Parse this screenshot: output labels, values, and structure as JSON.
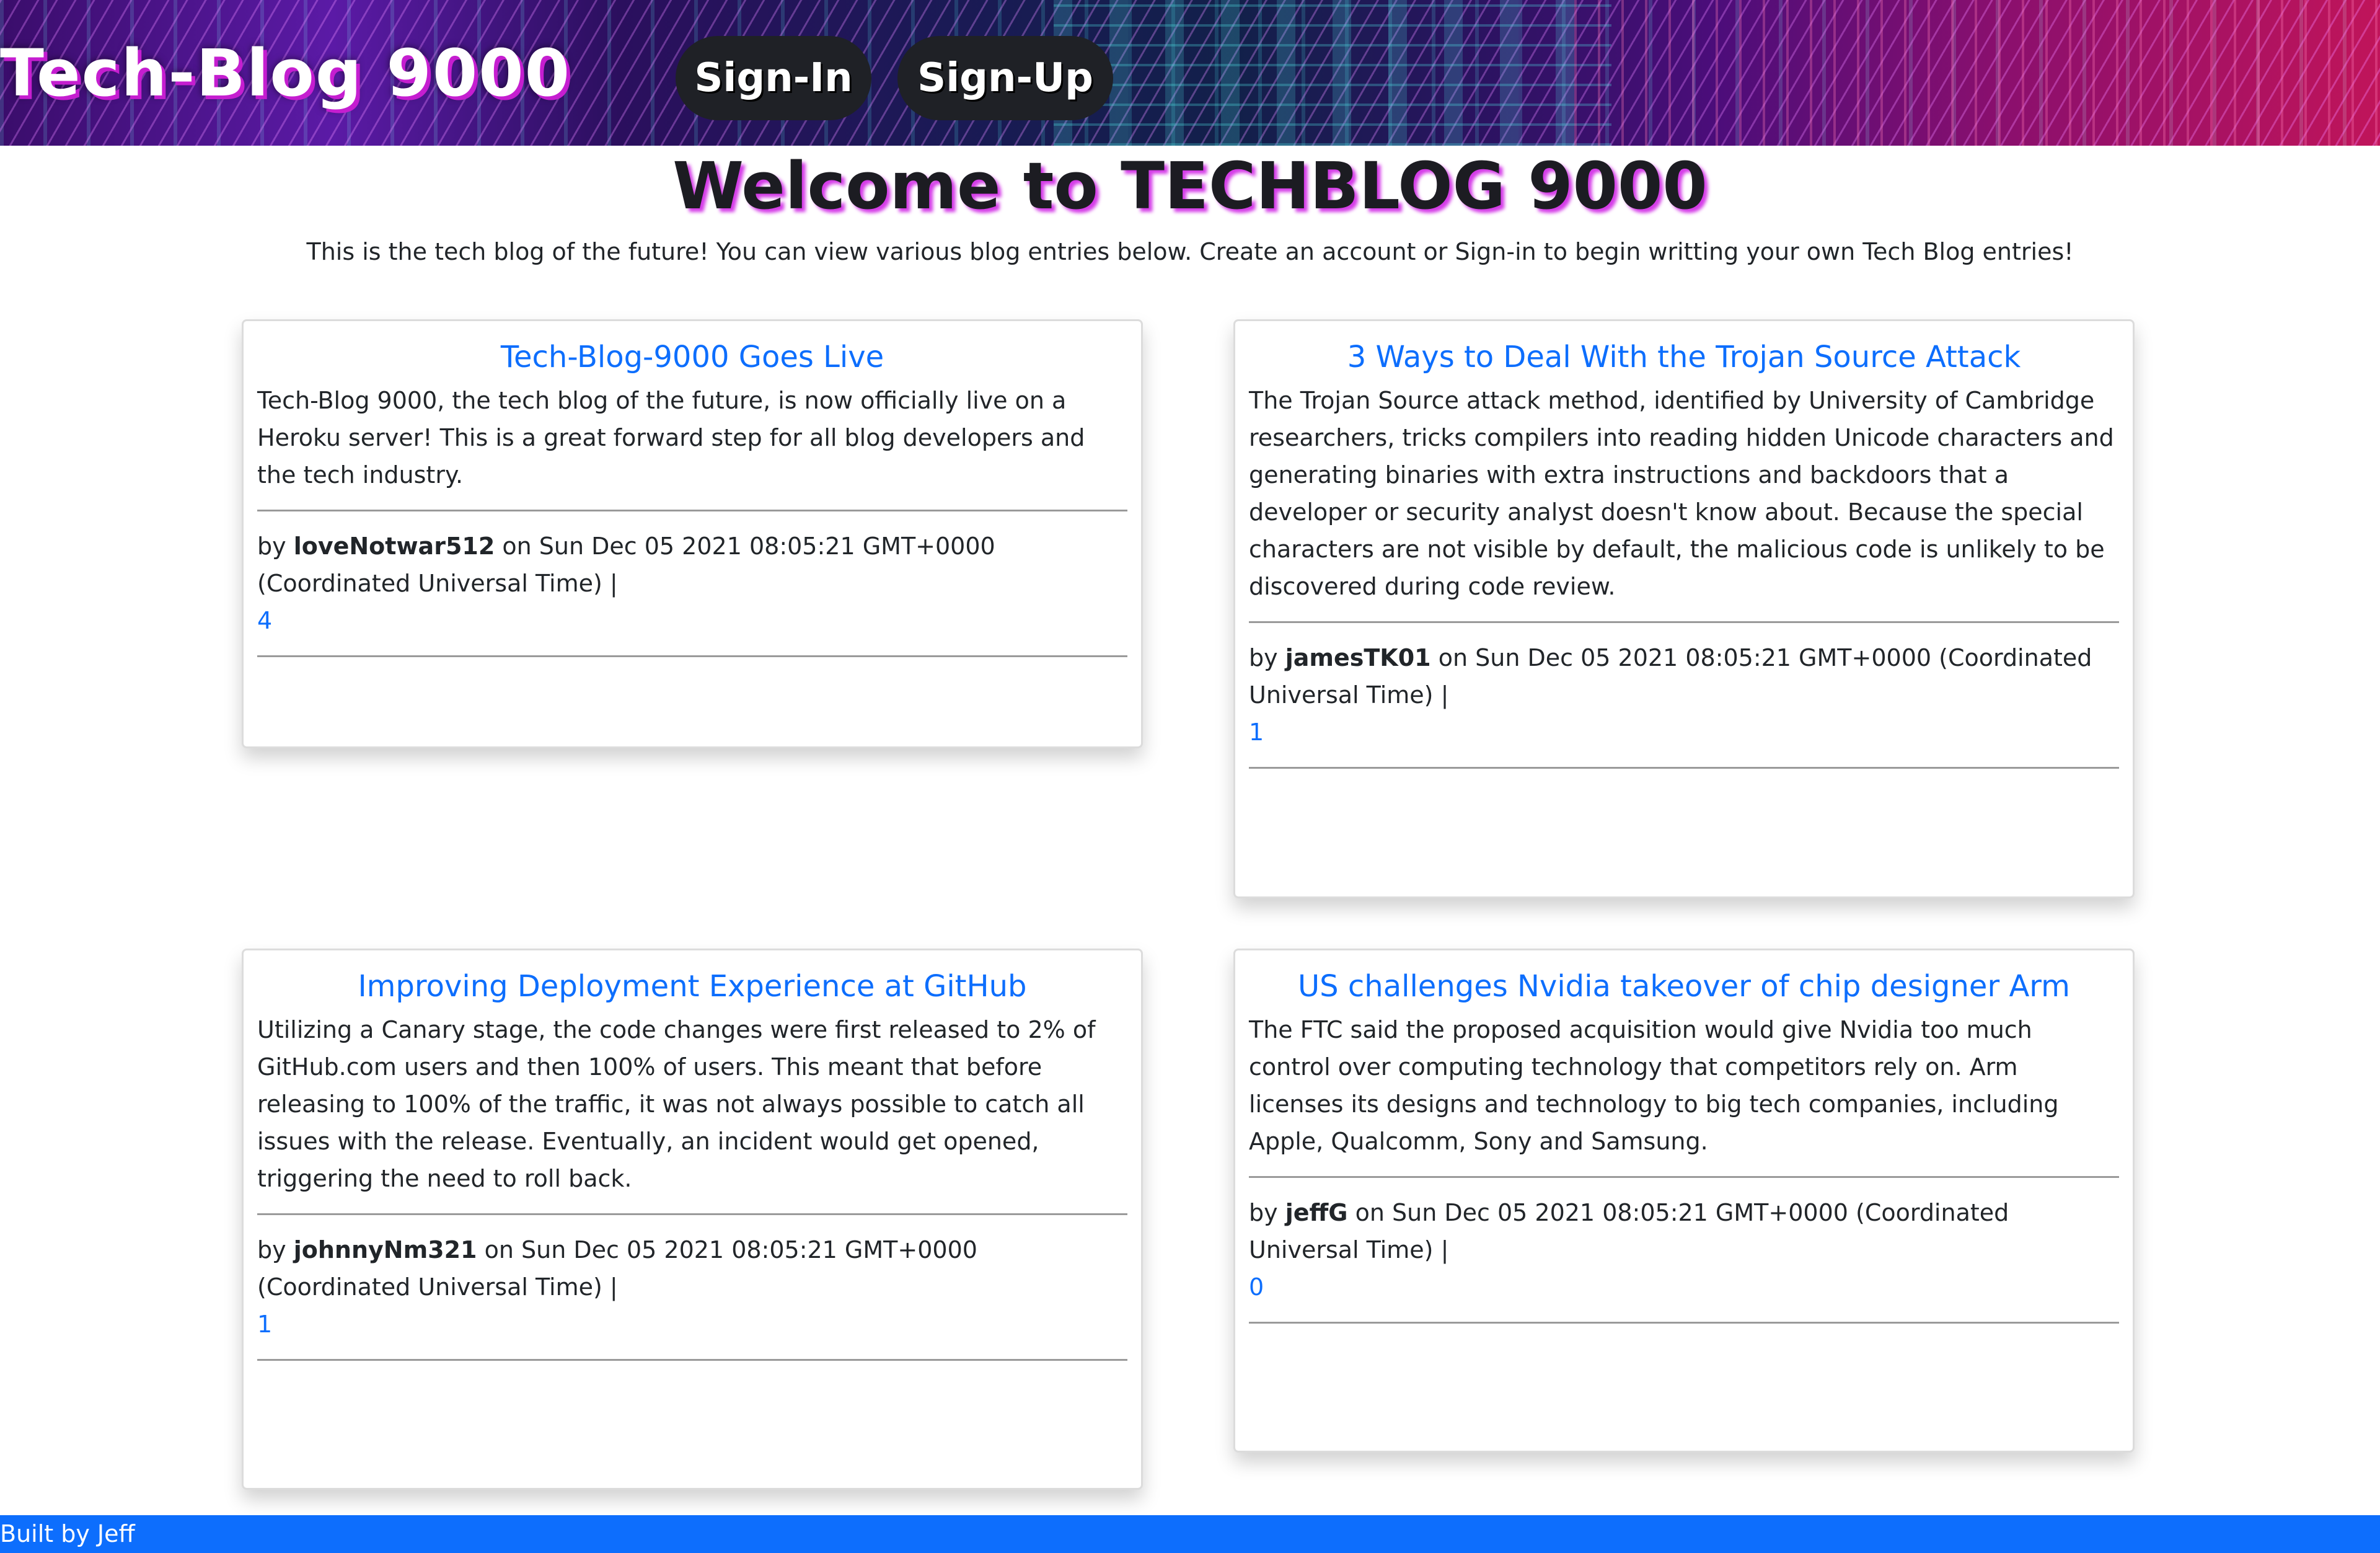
{
  "header": {
    "brand": "Tech-Blog 9000",
    "signin_label": "Sign-In",
    "signup_label": "Sign-Up"
  },
  "intro": {
    "title": "Welcome to TECHBLOG 9000",
    "text": "This is the tech blog of the future! You can view various blog entries below. Create an account or Sign-in to begin writting your own Tech Blog entries!"
  },
  "posts": [
    {
      "title": "Tech-Blog-9000 Goes Live",
      "body": "Tech-Blog 9000, the tech blog of the future, is now officially live on a Heroku server! This is a great forward step for all blog developers and the tech industry.",
      "by_prefix": "by",
      "author": "loveNotwar512",
      "date_text": "on Sun Dec 05 2021 08:05:21 GMT+0000 (Coordinated Universal Time) |",
      "comments": "4"
    },
    {
      "title": "3 Ways to Deal With the Trojan Source Attack",
      "body": "The Trojan Source attack method, identified by University of Cambridge researchers, tricks compilers into reading hidden Unicode characters and generating binaries with extra instructions and backdoors that a developer or security analyst doesn't know about. Because the special characters are not visible by default, the malicious code is unlikely to be discovered during code review.",
      "by_prefix": "by",
      "author": "jamesTK01",
      "date_text": "on Sun Dec 05 2021 08:05:21 GMT+0000 (Coordinated Universal Time) |",
      "comments": "1"
    },
    {
      "title": "Improving Deployment Experience at GitHub",
      "body": "Utilizing a Canary stage, the code changes were first released to 2% of GitHub.com users and then 100% of users. This meant that before releasing to 100% of the traffic, it was not always possible to catch all issues with the release. Eventually, an incident would get opened, triggering the need to roll back.",
      "by_prefix": "by",
      "author": "johnnyNm321",
      "date_text": "on Sun Dec 05 2021 08:05:21 GMT+0000 (Coordinated Universal Time) |",
      "comments": "1"
    },
    {
      "title": "US challenges Nvidia takeover of chip designer Arm",
      "body": "The FTC said the proposed acquisition would give Nvidia too much control over computing technology that competitors rely on. Arm licenses its designs and technology to big tech companies, including Apple, Qualcomm, Sony and Samsung.",
      "by_prefix": "by",
      "author": "jeffG",
      "date_text": "on Sun Dec 05 2021 08:05:21 GMT+0000 (Coordinated Universal Time) |",
      "comments": "0"
    }
  ],
  "footer": {
    "text": "Built by Jeff"
  },
  "colors": {
    "link": "#0d6efd",
    "footer_bg": "#0d6efd",
    "nav_button_bg": "#1f2126",
    "title_glow": "#d53ce8"
  }
}
